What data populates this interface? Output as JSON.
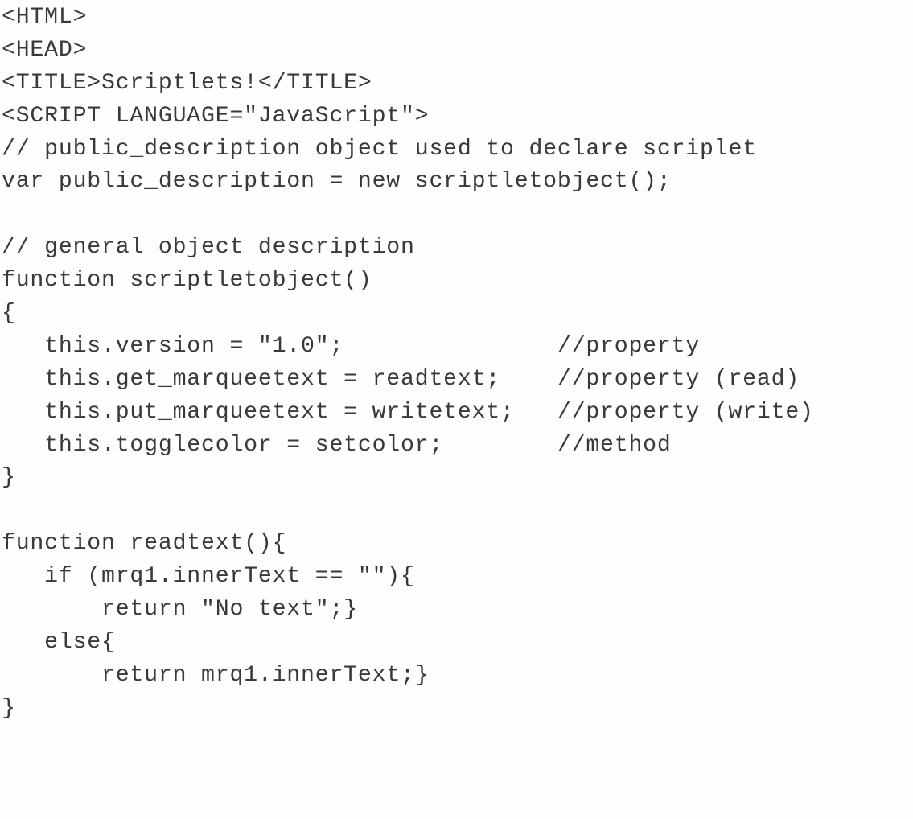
{
  "code": {
    "lines": [
      "<HTML>",
      "<HEAD>",
      "<TITLE>Scriptlets!</TITLE>",
      "<SCRIPT LANGUAGE=\"JavaScript\">",
      "// public_description object used to declare scriplet",
      "var public_description = new scriptletobject();",
      "",
      "// general object description",
      "function scriptletobject()",
      "{",
      "   this.version = \"1.0\";               //property",
      "   this.get_marqueetext = readtext;    //property (read)",
      "   this.put_marqueetext = writetext;   //property (write)",
      "   this.togglecolor = setcolor;        //method",
      "}",
      "",
      "function readtext(){",
      "   if (mrq1.innerText == \"\"){",
      "       return \"No text\";}",
      "   else{",
      "       return mrq1.innerText;}",
      "}"
    ]
  }
}
